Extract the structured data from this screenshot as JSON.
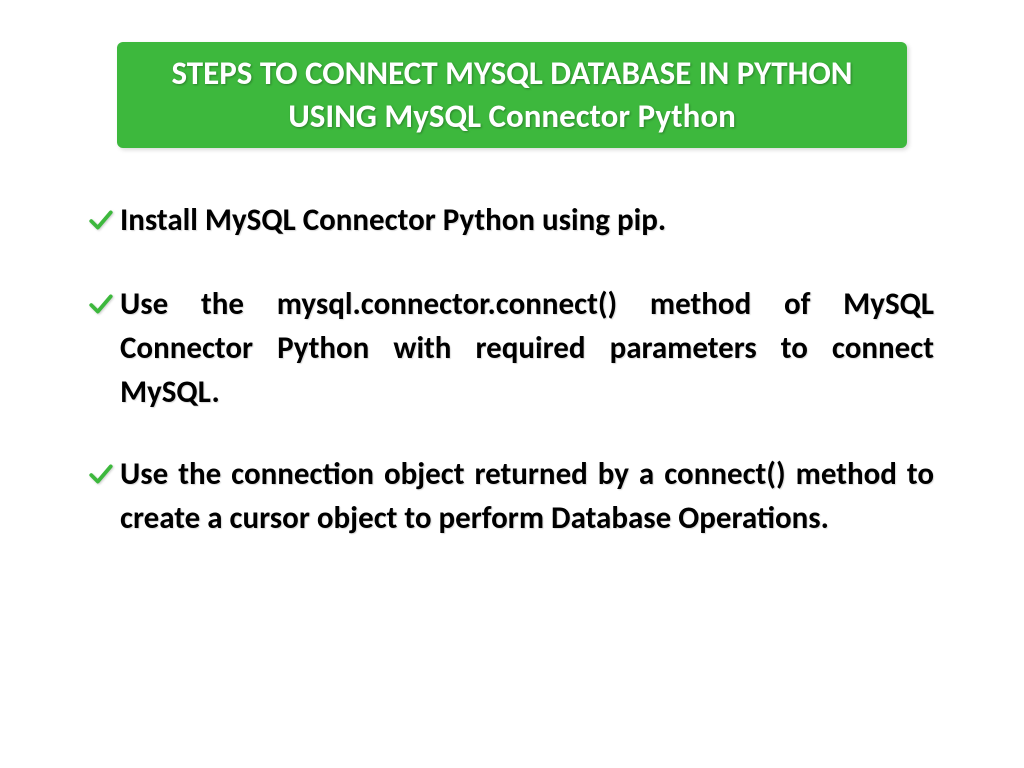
{
  "title": "STEPS TO CONNECT MYSQL DATABASE IN PYTHON USING MySQL Connector Python",
  "bullets": [
    "Install MySQL Connector Python using pip.",
    "Use the  mysql.connector.connect()  method of MySQL Connector Python with required parameters to connect MySQL.",
    "Use the connection object returned by a  connect()  method to create a cursor object to perform Database Operations."
  ],
  "colors": {
    "accent": "#3db83d",
    "text": "#000000",
    "title_text": "#ffffff"
  }
}
